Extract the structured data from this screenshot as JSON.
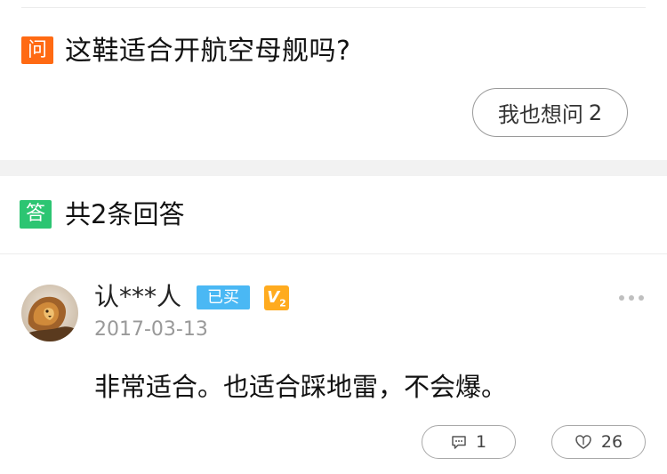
{
  "question": {
    "badge": "问",
    "title": "这鞋适合开航空母舰吗?",
    "ask_button_label": "我也想问",
    "ask_count": "2"
  },
  "answers_header": {
    "badge": "答",
    "count_label": "共2条回答"
  },
  "answer": {
    "username": "认***人",
    "bought_badge": "已买",
    "level_badge": "V",
    "level_sub": "2",
    "date": "2017-03-13",
    "text": "非常适合。也适合踩地雷，不会爆。",
    "comment_count": "1",
    "like_count": "26"
  },
  "colors": {
    "question_badge": "#ff6a13",
    "answer_badge": "#2cc572",
    "bought_badge": "#4ab8f4",
    "level_badge": "#ffab1f"
  },
  "icons": [
    "more-dots-icon",
    "comment-icon",
    "like-icon",
    "avatar-lion-image"
  ]
}
